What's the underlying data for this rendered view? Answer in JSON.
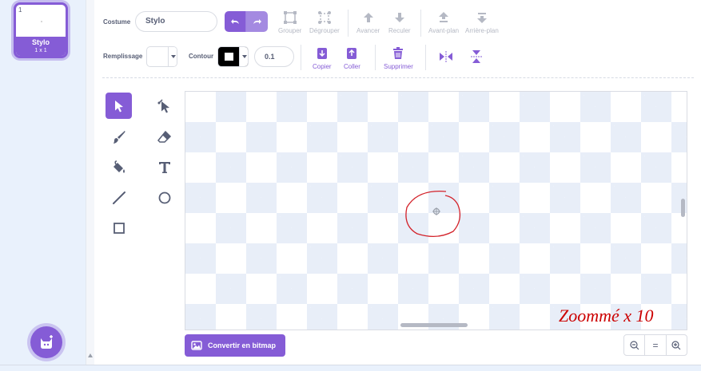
{
  "costume_list": {
    "items": [
      {
        "number": "1",
        "name": "Stylo",
        "size": "1 x 1",
        "selected": true
      }
    ],
    "add_button_icon": "cat-icon"
  },
  "toolbar": {
    "costume_label": "Costume",
    "costume_name": "Stylo",
    "undo_icon": "undo-icon",
    "redo_icon": "redo-icon",
    "group": "Grouper",
    "ungroup": "Dégrouper",
    "forward": "Avancer",
    "backward": "Reculer",
    "front": "Avant-plan",
    "back": "Arrière-plan",
    "fill_label": "Remplissage",
    "outline_label": "Contour",
    "outline_width": "0.1",
    "copy": "Copier",
    "paste": "Coller",
    "delete": "Supprimer",
    "flip_horizontal_icon": "flip-horizontal-icon",
    "flip_vertical_icon": "flip-vertical-icon"
  },
  "tools": [
    {
      "name": "select-tool",
      "icon": "arrow-icon",
      "active": true
    },
    {
      "name": "reshape-tool",
      "icon": "reshape-icon",
      "active": false
    },
    {
      "name": "brush-tool",
      "icon": "brush-icon",
      "active": false
    },
    {
      "name": "eraser-tool",
      "icon": "eraser-icon",
      "active": false
    },
    {
      "name": "fill-tool",
      "icon": "bucket-icon",
      "active": false
    },
    {
      "name": "text-tool",
      "icon": "text-icon",
      "active": false
    },
    {
      "name": "line-tool",
      "icon": "line-icon",
      "active": false
    },
    {
      "name": "circle-tool",
      "icon": "circle-icon",
      "active": false
    },
    {
      "name": "rectangle-tool",
      "icon": "rectangle-icon",
      "active": false
    }
  ],
  "canvas": {
    "annotation": "Zoommé x 10",
    "annotation_color": "#cc0000"
  },
  "footer": {
    "convert_button": "Convertir en bitmap",
    "zoom_out": "−",
    "zoom_reset": "=",
    "zoom_in": "+"
  },
  "colors": {
    "accent": "#855cd6",
    "fill": "#ffffff",
    "outline": "#000000",
    "text": "#575e75"
  }
}
